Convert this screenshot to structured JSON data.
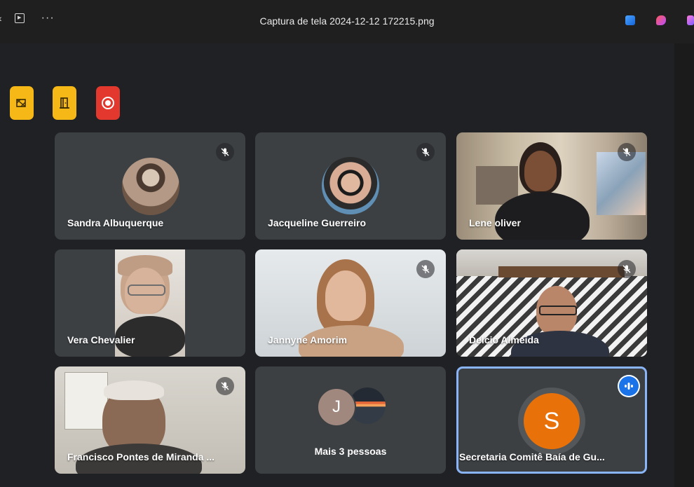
{
  "titlebar": {
    "title": "Captura de tela 2024-12-12 172215.png",
    "left_icons": [
      "back-icon",
      "play-icon",
      "more-icon"
    ],
    "more_glyph": "···",
    "right_icons": [
      "photos-app-icon",
      "copilot-icon",
      "clipchamp-icon"
    ]
  },
  "toolbar": {
    "buttons": [
      {
        "icon": "no-video-icon",
        "color": "#f6b817"
      },
      {
        "icon": "exit-door-icon",
        "color": "#f6b817"
      },
      {
        "icon": "record-icon",
        "color": "#e3382d"
      }
    ]
  },
  "participants": [
    {
      "name": "Sandra Albuquerque",
      "muted": true
    },
    {
      "name": "Jacqueline Guerreiro",
      "muted": true
    },
    {
      "name": "Lene oliver",
      "muted": true
    },
    {
      "name": "Vera Chevalier",
      "muted": false
    },
    {
      "name": "Jannyne Amorim",
      "muted": true
    },
    {
      "name": "Delcio Almeida",
      "muted": true
    },
    {
      "name": "Francisco Pontes de Miranda ...",
      "muted": true
    },
    {
      "name": "Secretaria Comitê Baía de Gu...",
      "muted": false,
      "speaking": true,
      "initial": "S",
      "avatar_color": "#e8710a"
    }
  ],
  "others": {
    "label": "Mais 3 pessoas",
    "initial": "J",
    "avatar_color": "#a1887f"
  },
  "colors": {
    "tile_bg": "#3c4043",
    "active_border": "#8ab4f8",
    "speaking_badge": "#1a73e8"
  }
}
